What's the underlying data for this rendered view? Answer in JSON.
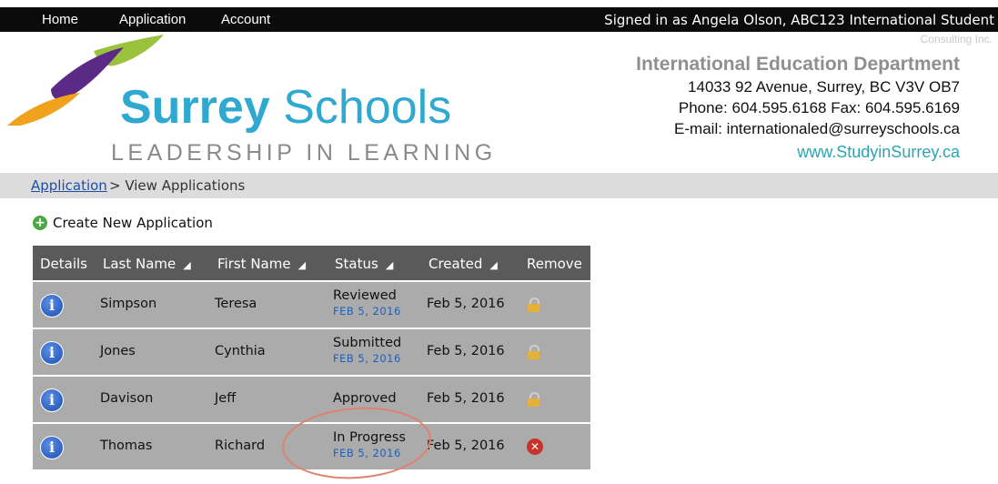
{
  "nav": {
    "items": [
      "Home",
      "Application",
      "Account"
    ],
    "signed_in": "Signed in as Angela Olson, ABC123 International Student",
    "signed_in_cont": "Consulting Inc."
  },
  "logo": {
    "name_bold": "Surrey",
    "name_rest": " Schools",
    "tagline": "LEADERSHIP IN LEARNING"
  },
  "department": {
    "title": "International Education Department",
    "address": "14033 92 Avenue, Surrey, BC   V3V OB7",
    "phone": "Phone: 604.595.6168  Fax: 604.595.6169",
    "email": "E-mail: internationaled@surreyschools.ca",
    "web": "www.StudyinSurrey.ca"
  },
  "breadcrumb": {
    "link": "Application",
    "rest": "> View Applications"
  },
  "create_label": "Create New Application",
  "table": {
    "headers": [
      "Details",
      "Last Name",
      "First Name",
      "Status",
      "Created",
      "Remove"
    ],
    "rows": [
      {
        "last": "Simpson",
        "first": "Teresa",
        "status": "Reviewed",
        "status_date": "FEB 5, 2016",
        "created": "Feb 5, 2016",
        "remove": "lock-icon"
      },
      {
        "last": "Jones",
        "first": "Cynthia",
        "status": "Submitted",
        "status_date": "FEB 5, 2016",
        "created": "Feb 5, 2016",
        "remove": "lock-icon"
      },
      {
        "last": "Davison",
        "first": "Jeff",
        "status": "Approved",
        "status_date": "",
        "created": "Feb 5, 2016",
        "remove": "lock-icon"
      },
      {
        "last": "Thomas",
        "first": "Richard",
        "status": "In Progress",
        "status_date": "FEB 5, 2016",
        "created": "Feb 5, 2016",
        "remove": "delete-icon"
      }
    ]
  },
  "colors": {
    "topbar": "#0b0b0b",
    "brand_blue": "#2fa9cf",
    "table_header": "#5a5a5a",
    "table_row": "#ababab",
    "link": "#1e4fa8",
    "annotation": "#e0816d"
  }
}
